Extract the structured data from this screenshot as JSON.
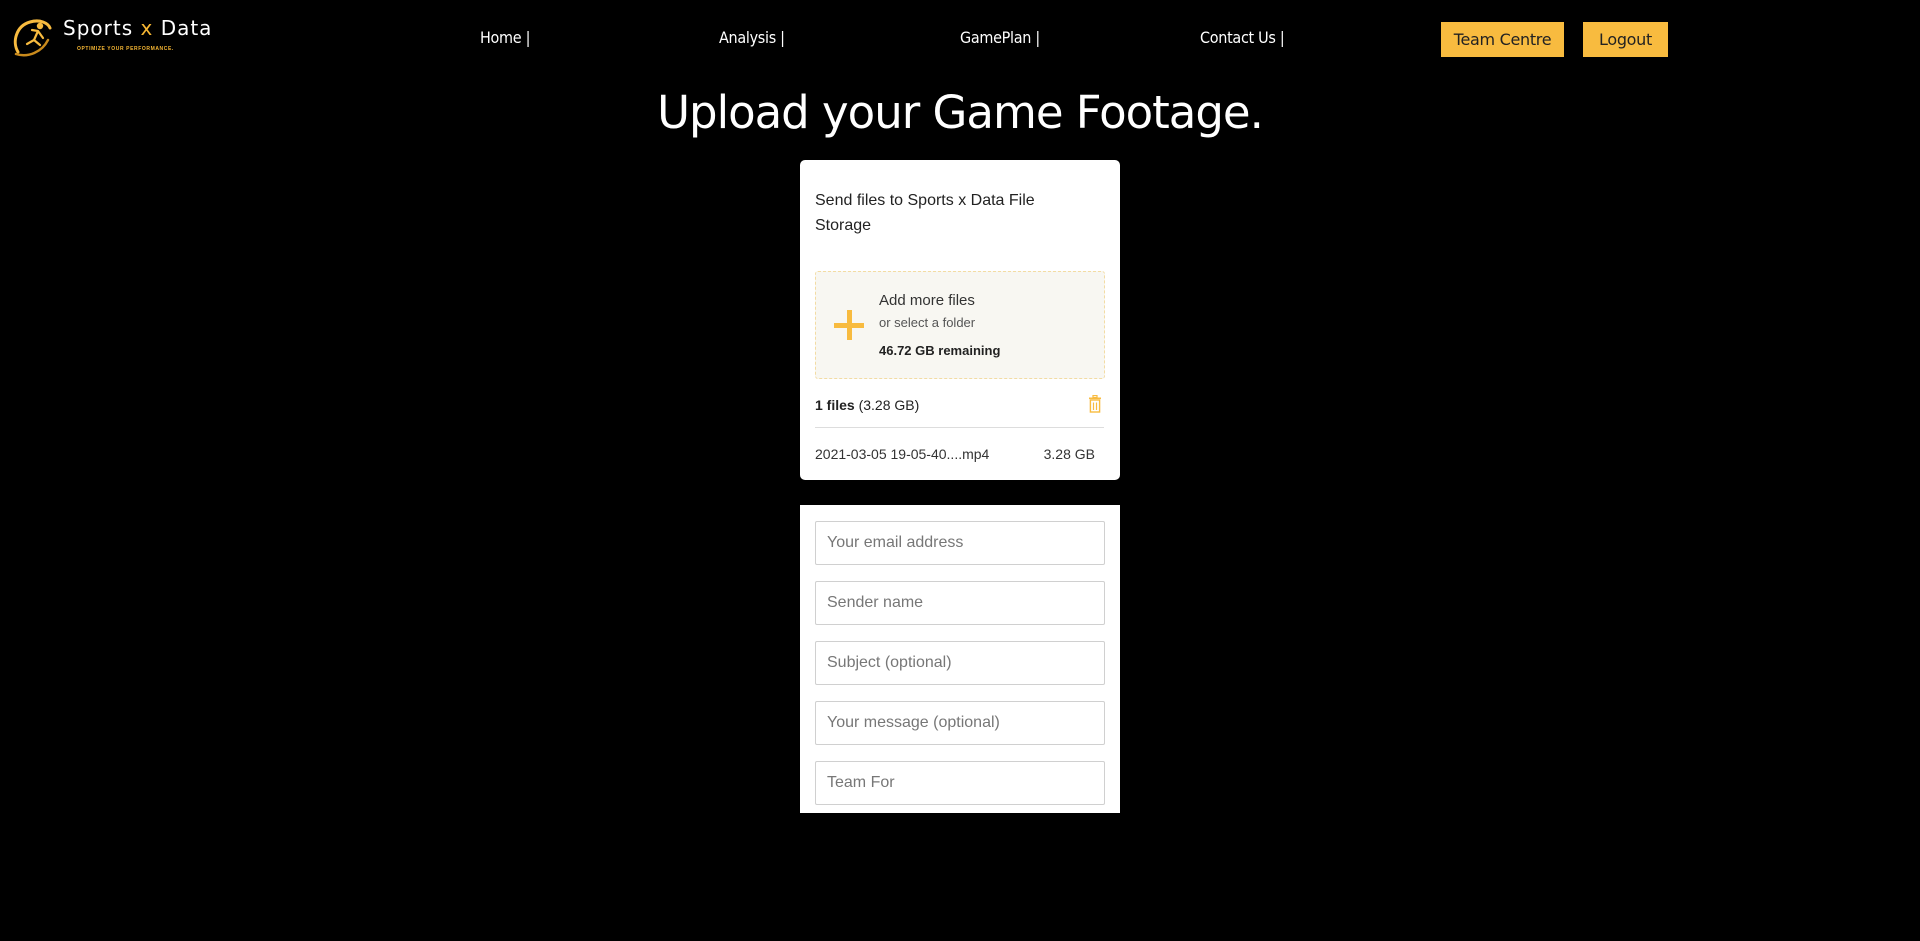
{
  "brand": {
    "name_part1": "Sports",
    "name_x": "x",
    "name_part2": "Data",
    "tagline": "OPTIMIZE YOUR PERFORMANCE.",
    "accent_color": "#f8bb3f"
  },
  "nav": {
    "items": [
      {
        "label": "Home |"
      },
      {
        "label": "Analysis |"
      },
      {
        "label": "GamePlan |"
      },
      {
        "label": "Contact Us |"
      }
    ],
    "team_centre_label": "Team Centre",
    "logout_label": "Logout"
  },
  "page_title": "Upload your Game Footage.",
  "upload": {
    "heading": "Send files to Sports x Data File Storage",
    "add_more": "Add more files",
    "select_folder": "or select a folder",
    "remaining": "46.72 GB remaining",
    "file_count_bold": "1 files",
    "file_count_size": "(3.28 GB)",
    "files": [
      {
        "name": "2021-03-05 19-05-40....mp4",
        "size": "3.28 GB"
      }
    ],
    "icons": {
      "add": "plus-icon",
      "clear": "trash-icon"
    }
  },
  "form": {
    "email_placeholder": "Your email address",
    "sender_placeholder": "Sender name",
    "subject_placeholder": "Subject (optional)",
    "message_placeholder": "Your message (optional)",
    "team_placeholder": "Team For"
  }
}
